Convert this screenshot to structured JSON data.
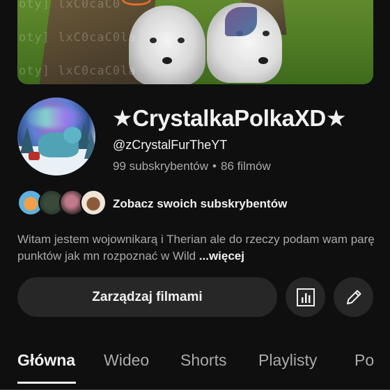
{
  "banner": {
    "watermark_lines": [
      "oty] lxC0caC0",
      "oty] lxC0caC0la",
      "oty] lxC0caC0la"
    ]
  },
  "channel": {
    "name": "★CrystalkaPolkaXD★",
    "handle": "@zCrystalFurTheYT",
    "subscribers": "99 subskrybentów",
    "separator": "•",
    "videos": "86 filmów"
  },
  "subscribers_row": {
    "link_label": "Zobacz swoich subskrybentów"
  },
  "description": {
    "text": "Witam jestem wojownikarą i Therian ale do rzeczy podam wam parę punktów jak mn rozpoznać w Wild",
    "more_label": "...więcej"
  },
  "actions": {
    "manage_label": "Zarządzaj filmami",
    "stats_icon": "bar-chart-icon",
    "edit_icon": "pencil-icon"
  },
  "tabs": [
    {
      "label": "Główna",
      "active": true
    },
    {
      "label": "Wideo",
      "active": false
    },
    {
      "label": "Shorts",
      "active": false
    },
    {
      "label": "Playlisty",
      "active": false
    },
    {
      "label": "Po",
      "active": false
    }
  ]
}
